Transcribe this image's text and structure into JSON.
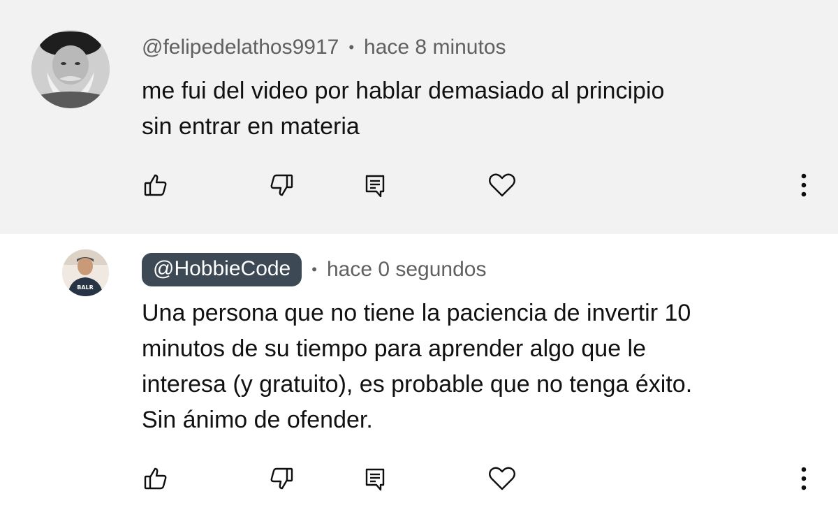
{
  "comments": [
    {
      "author": "@felipedelathos9917",
      "separator": "•",
      "time": "hace 8 minutos",
      "text": "me fui del video por hablar demasiado al principio\nsin entrar en materia",
      "is_owner": false,
      "actions": {
        "like_icon": "thumbs-up-icon",
        "dislike_icon": "thumbs-down-icon",
        "reply_icon": "reply-comment-icon",
        "heart_icon": "heart-icon",
        "more_icon": "more-vertical-icon"
      }
    },
    {
      "author": "@HobbieCode",
      "separator": "•",
      "time": "hace 0 segundos",
      "text": "Una persona que no tiene la paciencia de invertir 10\nminutos de su tiempo para aprender algo que le\ninteresa (y gratuito), es probable que no tenga éxito.\nSin ánimo de ofender.",
      "is_owner": true,
      "avatar_shirt_text": "BALR",
      "actions": {
        "like_icon": "thumbs-up-icon",
        "dislike_icon": "thumbs-down-icon",
        "reply_icon": "reply-comment-icon",
        "heart_icon": "heart-icon",
        "more_icon": "more-vertical-icon"
      }
    }
  ],
  "colors": {
    "highlight_background": "#f2f2f2",
    "owner_badge": "#3d4954",
    "meta_text": "#606060"
  }
}
